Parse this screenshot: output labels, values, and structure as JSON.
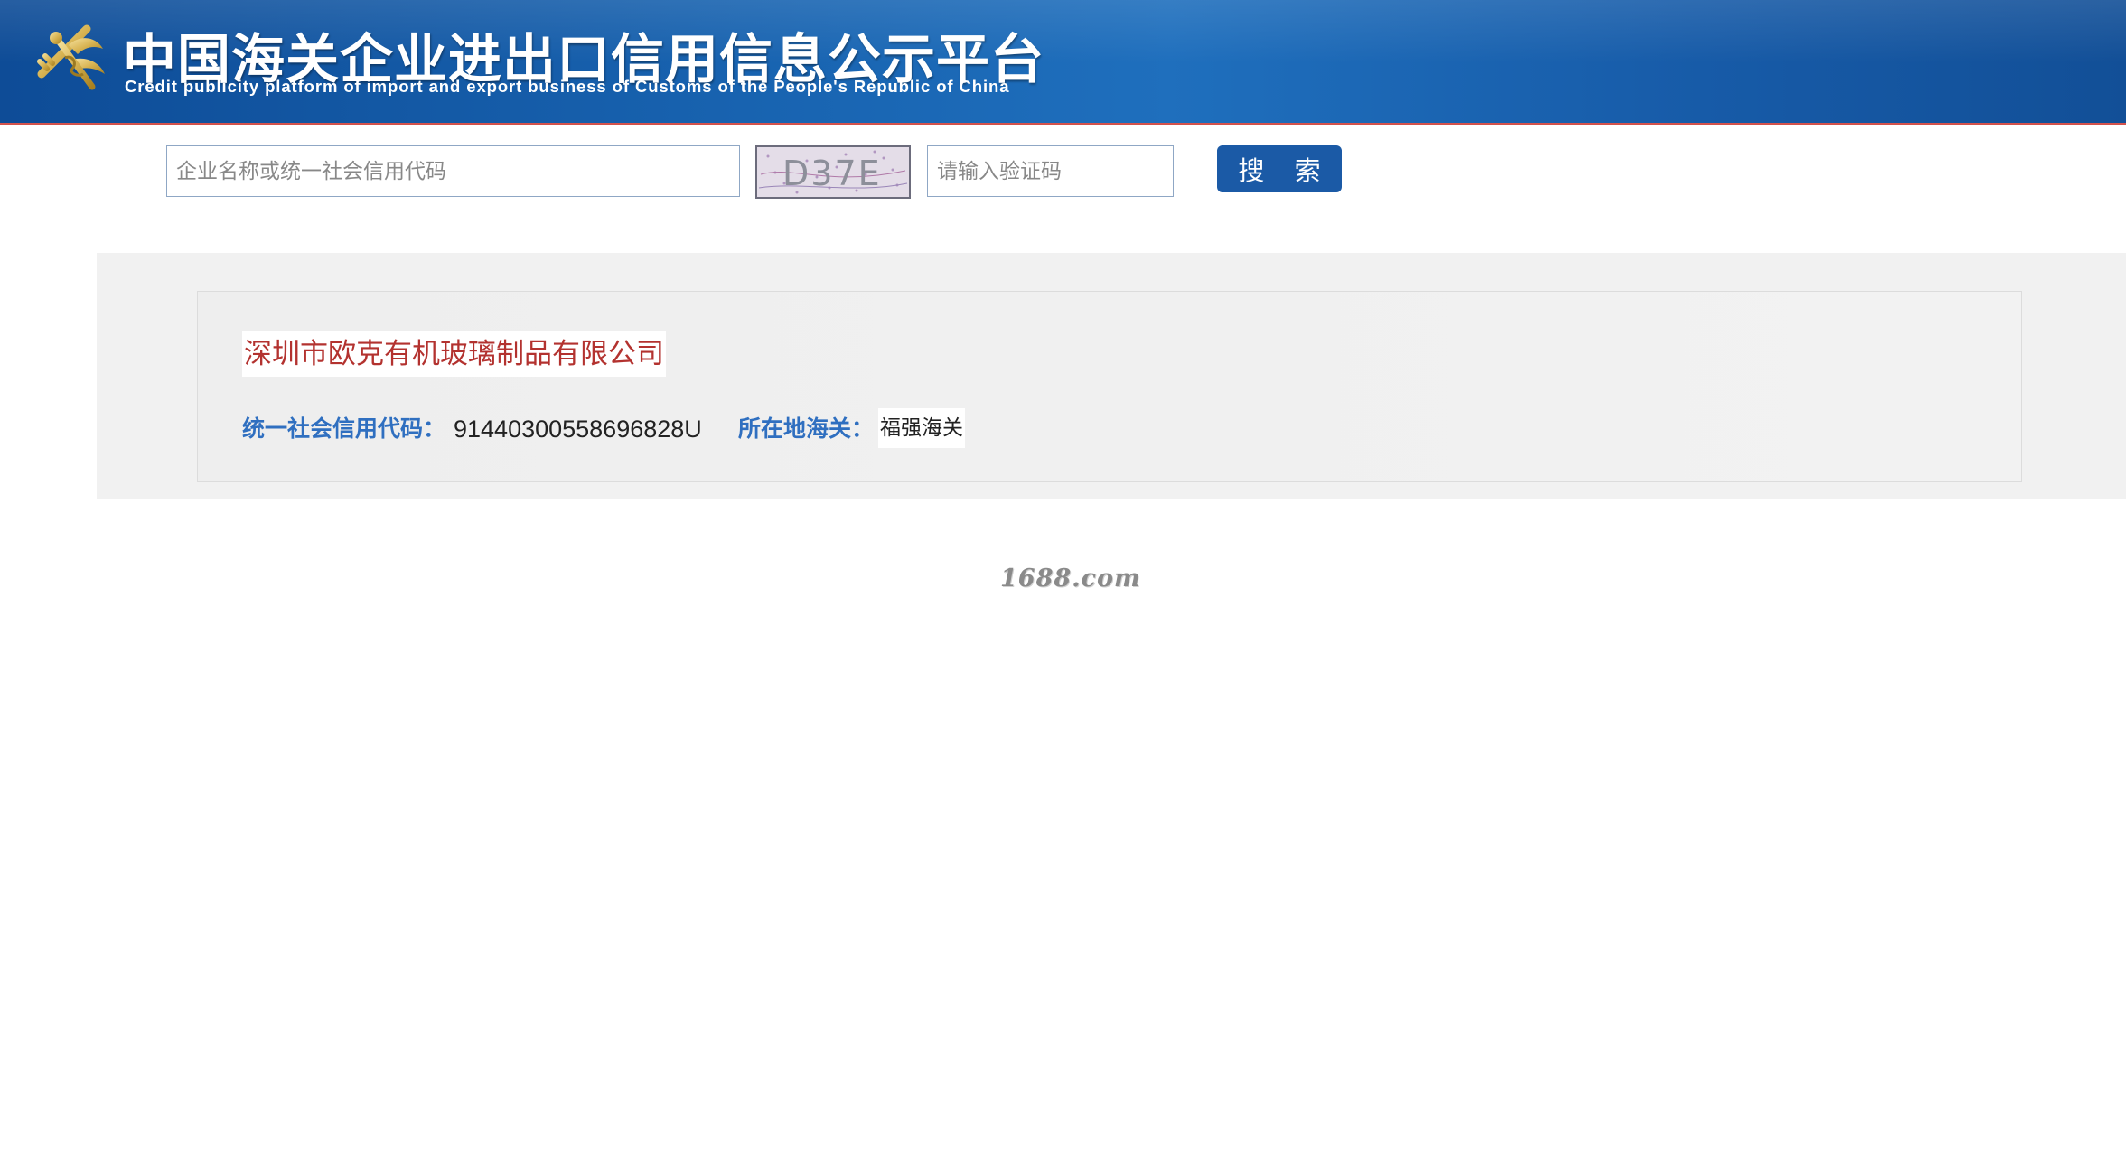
{
  "header": {
    "title_cn": "中国海关企业进出口信用信息公示平台",
    "title_en": "Credit publicity platform of import and export business of Customs of the People's Republic of China",
    "logo_icon": "customs-emblem-icon",
    "brand_color": "#1863b0",
    "stripe_color": "#c23a34"
  },
  "search": {
    "query_placeholder": "企业名称或统一社会信用代码",
    "query_value": "",
    "captcha_text": "D37E",
    "captcha_placeholder": "请输入验证码",
    "captcha_value": "",
    "button_label": "搜 索"
  },
  "result": {
    "company_name": "深圳市欧克有机玻璃制品有限公司",
    "credit_code_label": "统一社会信用代码：",
    "credit_code_value": "91440300558696828U",
    "customs_label": "所在地海关：",
    "customs_value": "福强海关",
    "name_color": "#b3322f",
    "label_color": "#2f6fc0"
  },
  "watermark": {
    "text": "1688.com"
  }
}
